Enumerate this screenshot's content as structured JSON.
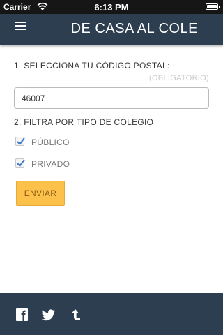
{
  "status_bar": {
    "carrier": "Carrier",
    "time": "6:13 PM",
    "wifi_icon": "wifi-icon",
    "battery_icon": "battery-icon"
  },
  "header": {
    "title": "DE CASA AL COLE",
    "menu_icon": "menu-icon",
    "background_color": "#2c3e50"
  },
  "form": {
    "step1_label": "1. SELECCIONA TU CÓDIGO POSTAL:",
    "required_note": "(OBLIGATORIO)",
    "zip_value": "46007",
    "step2_label": "2. FILTRA POR TIPO DE COLEGIO",
    "options": [
      {
        "label": "PÚBLICO",
        "checked": true
      },
      {
        "label": "PRIVADO",
        "checked": true
      }
    ],
    "submit_label": "ENVIAR",
    "submit_color": "#fbc14b"
  },
  "footer": {
    "icons": [
      "facebook-icon",
      "twitter-icon",
      "share-icon"
    ],
    "background_color": "#2c3e50"
  }
}
